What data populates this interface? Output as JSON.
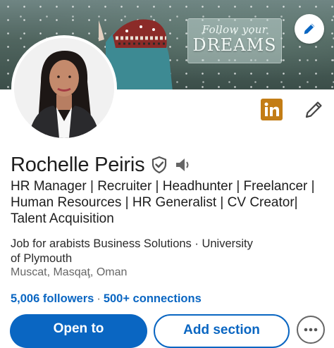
{
  "banner": {
    "slogan_line1": "Follow your",
    "slogan_line2": "DREAMS",
    "edit_icon": "pencil-icon"
  },
  "profile": {
    "name": "Rochelle Peiris",
    "headline_lines": [
      "HR Manager | Recruiter | Headhunter | Freelancer |",
      "Human Resources | HR Generalist | CV Creator|",
      "Talent Acquisition"
    ],
    "position_lines": [
      "Job for arabists Business Solutions · University",
      "of Plymouth"
    ],
    "location": "Muscat, Masqaţ, Oman",
    "followers": "5,006 followers",
    "separator": "·",
    "connections": "500+ connections"
  },
  "actions": {
    "open_to_label": "Open to",
    "add_section_label": "Add section",
    "more_icon": "ellipsis-icon",
    "linkedin_icon": "linkedin-icon",
    "edit_icon": "pencil-icon",
    "verified_icon": "verified-shield-icon",
    "pronunciation_icon": "speaker-icon"
  },
  "colors": {
    "accent": "#0a66c2",
    "linkedin_badge": "#c37d16",
    "text_primary": "#1d1d1d",
    "text_secondary": "#666666"
  }
}
